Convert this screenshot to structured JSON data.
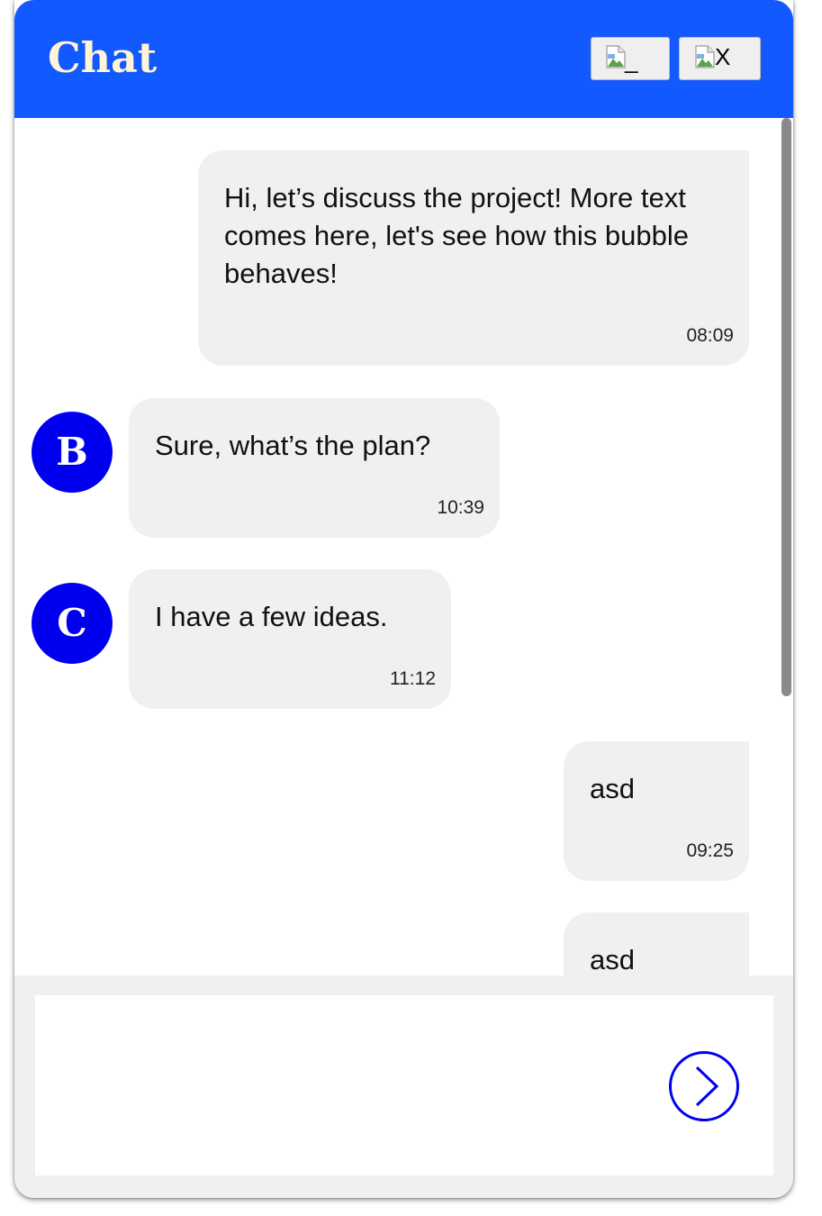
{
  "header": {
    "title": "Chat",
    "minimize_label": "_",
    "close_label": "X",
    "accent_color": "#1259ff",
    "title_color": "#fff4d6"
  },
  "messages": [
    {
      "side": "sent",
      "text": "Hi, let’s discuss the project! More text comes here, let's see how this bubble behaves!",
      "time": "08:09"
    },
    {
      "side": "received",
      "avatar": "B",
      "text": "Sure, what’s the plan?",
      "time": "10:39"
    },
    {
      "side": "received",
      "avatar": "C",
      "text": "I have a few ideas.",
      "time": "11:12"
    },
    {
      "side": "sent",
      "text": "asd",
      "time": "09:25"
    },
    {
      "side": "sent",
      "text": "asd",
      "time": ""
    }
  ],
  "composer": {
    "value": "",
    "placeholder": "",
    "send_icon": "send-arrow-circle-icon",
    "send_color": "#0000ee"
  },
  "avatar_color": "#0000ee",
  "bubble_color": "#f0f0f0"
}
